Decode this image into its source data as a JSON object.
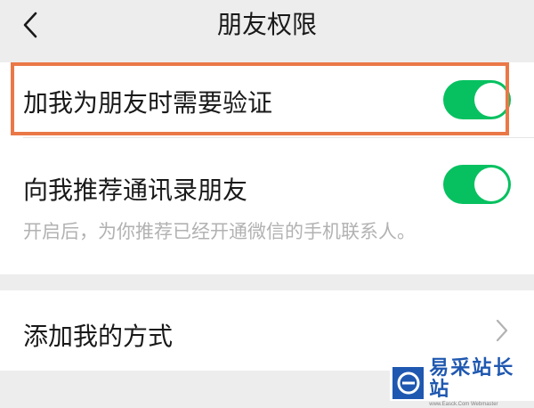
{
  "header": {
    "title": "朋友权限"
  },
  "settings": [
    {
      "label": "加我为朋友时需要验证",
      "enabled": true
    },
    {
      "label": "向我推荐通讯录朋友",
      "enabled": true,
      "description": "开启后，为你推荐已经开通微信的手机联系人。"
    },
    {
      "label": "添加我的方式"
    }
  ],
  "colors": {
    "switch_on": "#07c160",
    "highlight": "#ea7847",
    "background": "#ededed"
  },
  "watermark": {
    "name": "易采站长站",
    "url": "www.Easck.Com Webmaster"
  },
  "icons": {
    "back": "chevron-left-icon",
    "disclosure": "chevron-right-icon",
    "logo": "e-logo-icon"
  }
}
